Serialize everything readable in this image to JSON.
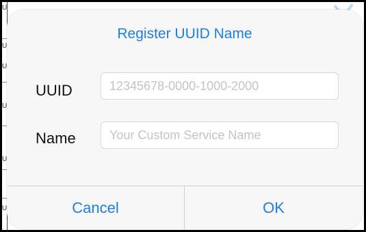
{
  "background": {
    "left_fragments": [
      "U",
      "U",
      "U",
      "U",
      "U",
      "U"
    ]
  },
  "dialog": {
    "title": "Register UUID Name",
    "fields": [
      {
        "label": "UUID",
        "value": "",
        "placeholder": "12345678-0000-1000-2000"
      },
      {
        "label": "Name",
        "value": "",
        "placeholder": "Your Custom Service Name"
      }
    ],
    "buttons": {
      "cancel": "Cancel",
      "ok": "OK"
    }
  },
  "colors": {
    "accent": "#1a7fe0",
    "dialog_bg": "#f7f7f7",
    "placeholder": "#c3c3c8"
  }
}
